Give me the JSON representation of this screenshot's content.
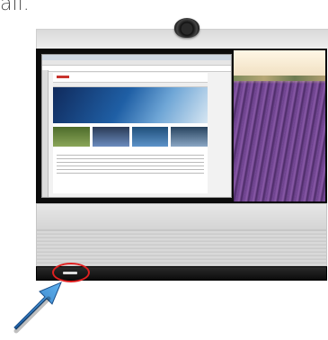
{
  "caption": {
    "text": "all."
  },
  "colors": {
    "highlight_ring": "#e02020",
    "arrow": "#2f86d6"
  },
  "icons": {
    "camera": "camera-icon",
    "arrow": "blue-arrow-icon",
    "power": "power-button"
  }
}
